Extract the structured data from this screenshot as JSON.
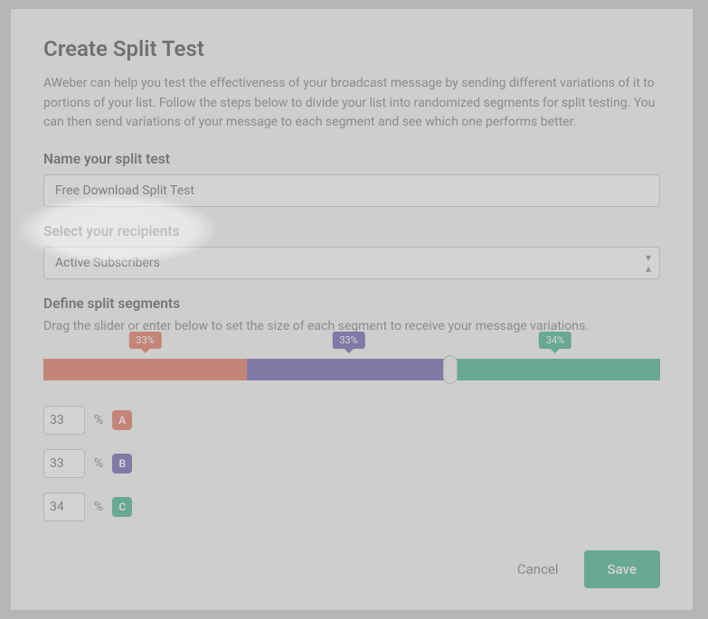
{
  "title": "Create Split Test",
  "description": "AWeber can help you test the effectiveness of your broadcast message by sending different variations of it to portions of your list. Follow the steps below to divide your list into randomized segments for split testing. You can then send variations of your message to each segment and see which one performs better.",
  "name_section": {
    "label": "Name your split test",
    "value": "Free Download Split Test"
  },
  "recipients_section": {
    "label": "Select your recipients",
    "selected": "Active Subscribers"
  },
  "segments_section": {
    "label": "Define split segments",
    "hint": "Drag the slider or enter below to set the size of each segment to receive your message variations.",
    "segments": [
      {
        "letter": "A",
        "percent": 33,
        "bubble": "33%",
        "color": "#e2705a"
      },
      {
        "letter": "B",
        "percent": 33,
        "bubble": "33%",
        "color": "#6a5aae"
      },
      {
        "letter": "C",
        "percent": 34,
        "bubble": "34%",
        "color": "#3bb08b"
      }
    ]
  },
  "footer": {
    "cancel": "Cancel",
    "save": "Save"
  },
  "percent_sign": "%"
}
